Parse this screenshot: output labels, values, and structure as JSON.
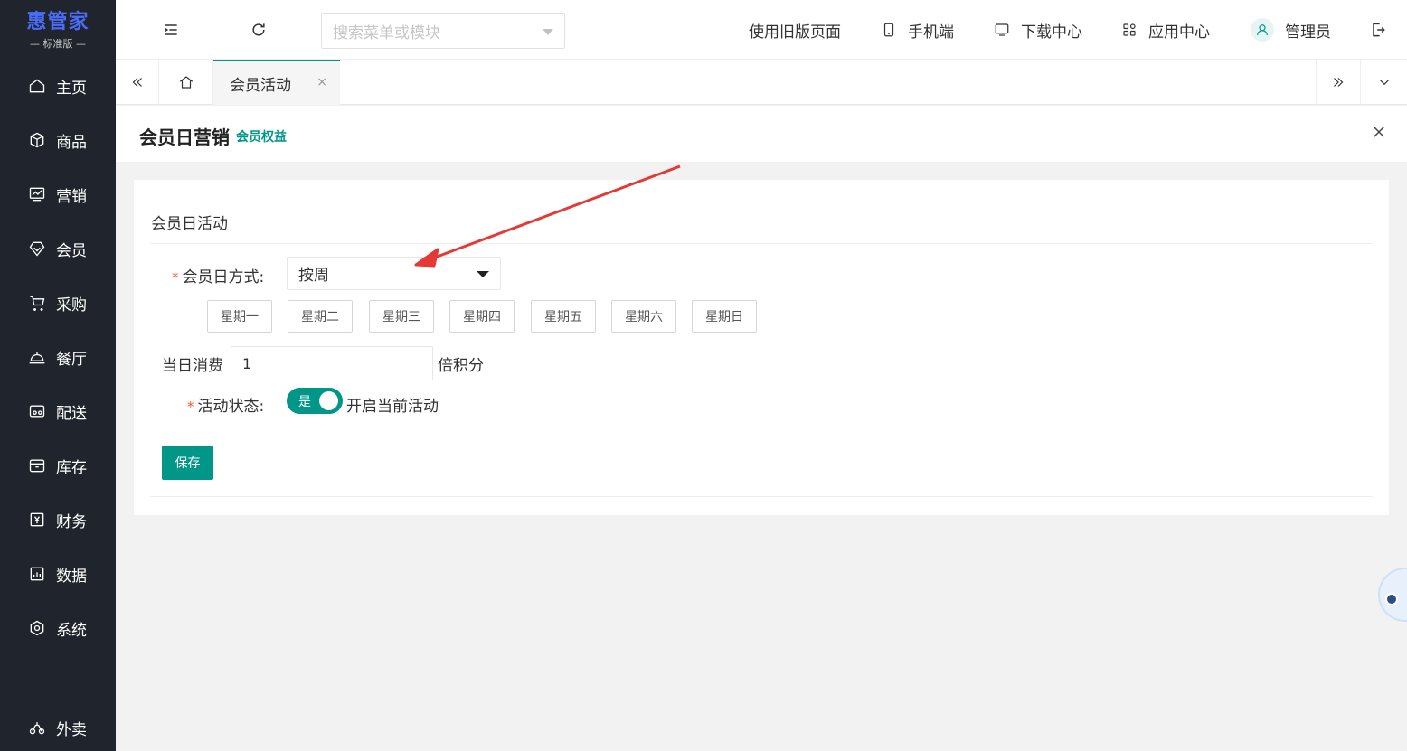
{
  "brand": {
    "name": "惠管家",
    "edition": "— 标准版 —"
  },
  "sidebar": {
    "items": [
      {
        "label": "主页",
        "icon": "home-icon"
      },
      {
        "label": "商品",
        "icon": "box-icon"
      },
      {
        "label": "营销",
        "icon": "chart-screen-icon"
      },
      {
        "label": "会员",
        "icon": "diamond-icon"
      },
      {
        "label": "采购",
        "icon": "cart-icon"
      },
      {
        "label": "餐厅",
        "icon": "bell-dish-icon"
      },
      {
        "label": "配送",
        "icon": "delivery-icon"
      },
      {
        "label": "库存",
        "icon": "inventory-icon"
      },
      {
        "label": "财务",
        "icon": "yen-icon"
      },
      {
        "label": "数据",
        "icon": "stats-icon"
      },
      {
        "label": "系统",
        "icon": "system-gear-icon"
      }
    ],
    "bottom_item": {
      "label": "外卖",
      "icon": "scooter-icon"
    }
  },
  "topbar": {
    "search_placeholder": "搜索菜单或模块",
    "old_version": "使用旧版页面",
    "mobile": "手机端",
    "downloads": "下载中心",
    "apps": "应用中心",
    "user": "管理员"
  },
  "tabs": {
    "active_label": "会员活动",
    "close_glyph": "×"
  },
  "page": {
    "title": "会员日营销",
    "subtitle": "会员权益"
  },
  "form": {
    "section_title": "会员日活动",
    "mode_label": "会员日方式:",
    "mode_value": "按周",
    "required_mark": "*",
    "days": [
      "星期一",
      "星期二",
      "星期三",
      "星期四",
      "星期五",
      "星期六",
      "星期日"
    ],
    "consume_label": "当日消费",
    "consume_value": "1",
    "consume_suffix": "倍积分",
    "status_label": "活动状态:",
    "status_on_text": "是",
    "status_desc": "开启当前活动",
    "save_label": "保存"
  },
  "colors": {
    "sidebar_bg": "#20242c",
    "accent": "#009688",
    "brand_blue": "#4a6cf7",
    "annotation_arrow": "#e53935"
  }
}
